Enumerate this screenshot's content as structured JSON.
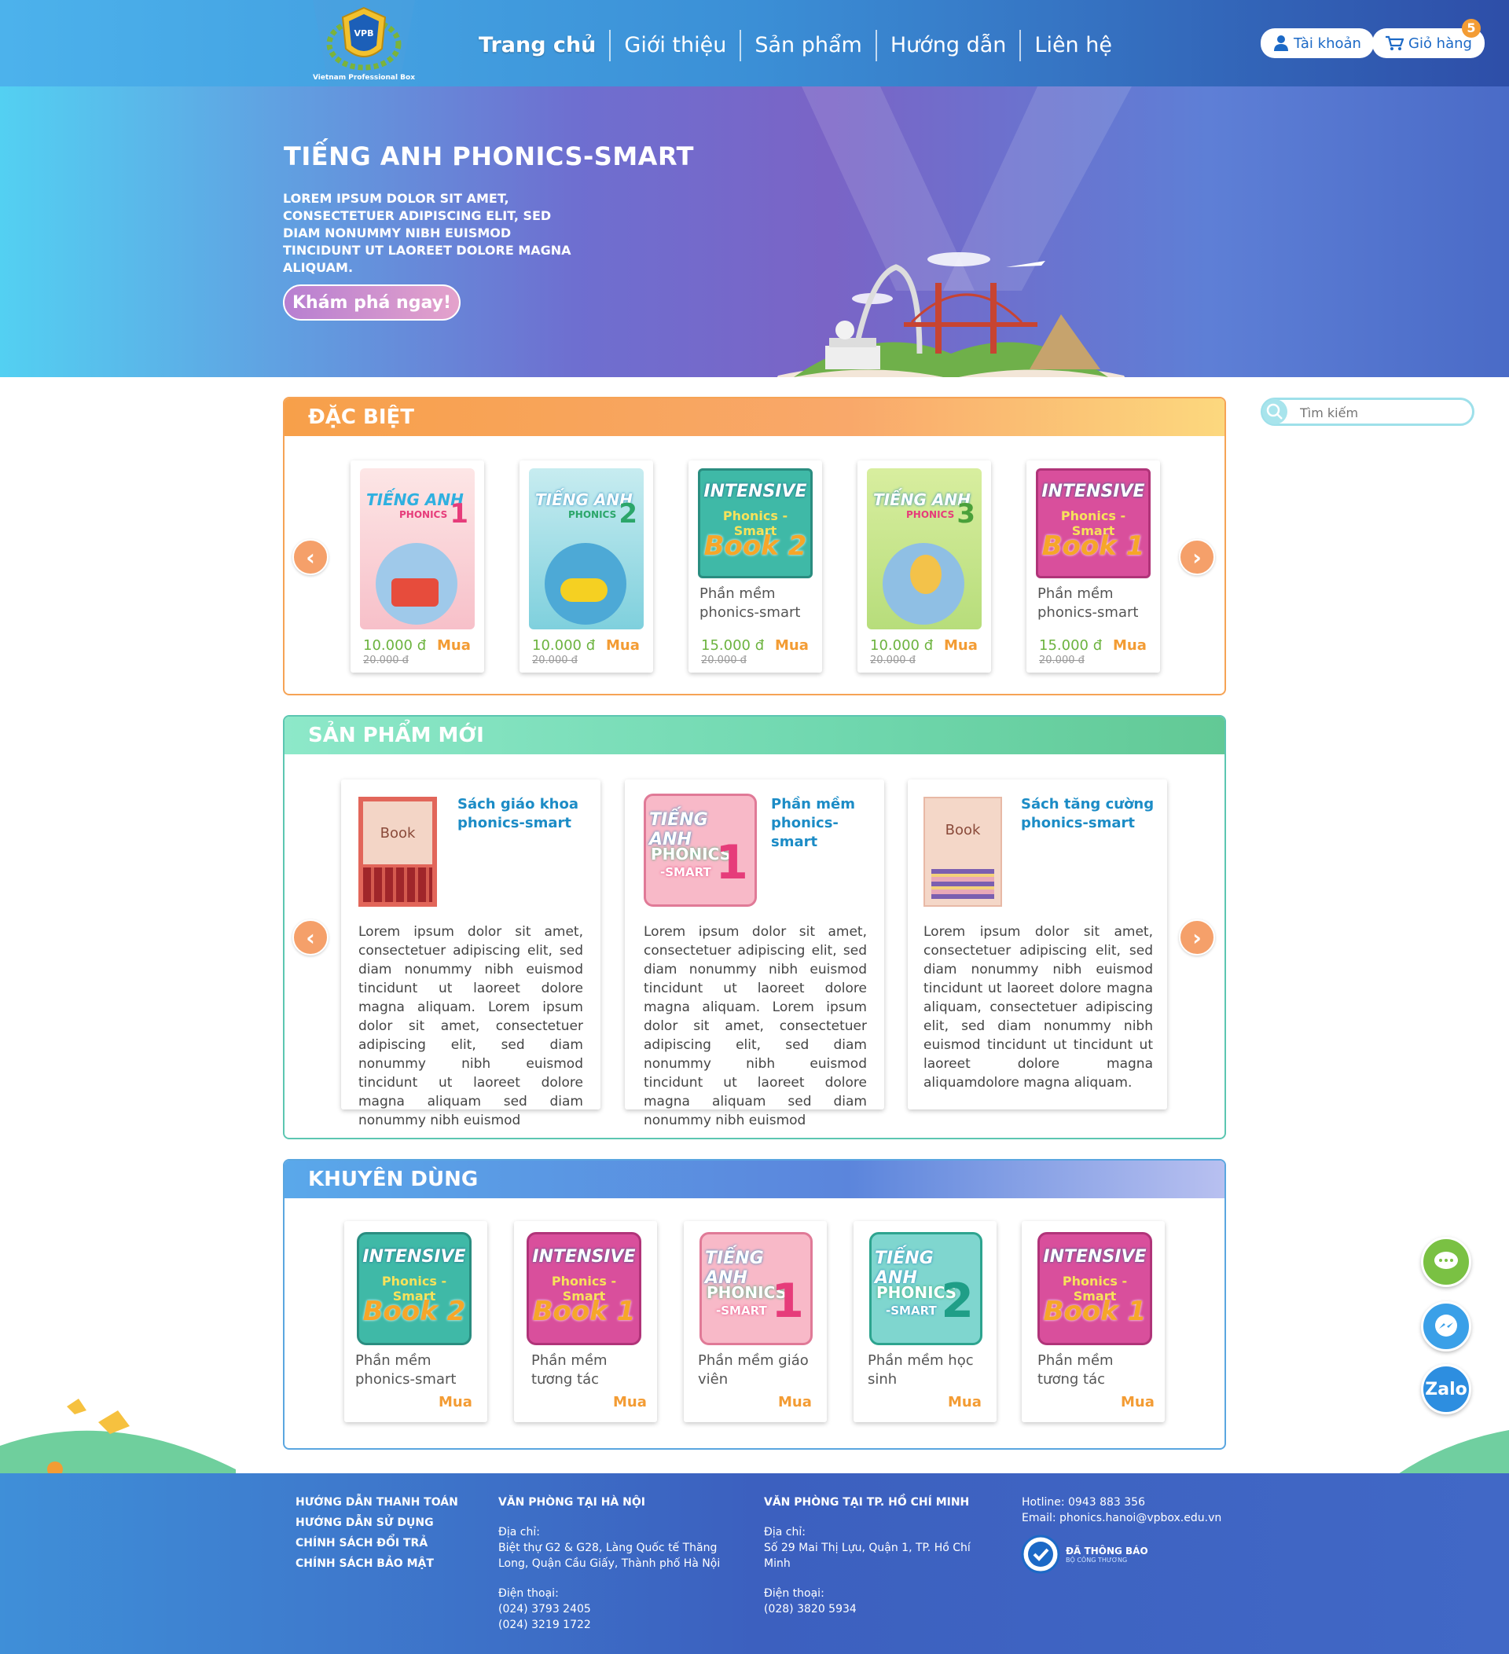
{
  "header": {
    "logo_text": "Vietnam Professional Box",
    "nav": [
      "Trang chủ",
      "Giới thiệu",
      "Sản phẩm",
      "Hướng dẫn",
      "Liên hệ"
    ],
    "account_label": "Tài khoản",
    "cart_label": "Giỏ hàng",
    "cart_count": "5"
  },
  "hero": {
    "title": "TIẾNG ANH PHONICS-SMART",
    "text": "LOREM IPSUM DOLOR SIT AMET, CONSECTETUER ADIPISCING ELIT, SED DIAM NONUMMY NIBH EUISMOD TINCIDUNT UT LAOREET DOLORE MAGNA ALIQUAM.",
    "button": "Khám phá ngay!"
  },
  "search": {
    "placeholder": "Tìm kiếm"
  },
  "special": {
    "title": "ĐẶC BIỆT",
    "items": [
      {
        "cover": "tieng-anh-1",
        "name": "",
        "price": "10.000 đ",
        "old_price": "20.000 đ",
        "buy": "Mua"
      },
      {
        "cover": "tieng-anh-2",
        "name": "",
        "price": "10.000 đ",
        "old_price": "20.000 đ",
        "buy": "Mua"
      },
      {
        "cover": "intensive-book-2",
        "name": "Phần mềm phonics-smart",
        "price": "15.000 đ",
        "old_price": "20.000 đ",
        "buy": "Mua"
      },
      {
        "cover": "tieng-anh-3",
        "name": "",
        "price": "10.000 đ",
        "old_price": "20.000 đ",
        "buy": "Mua"
      },
      {
        "cover": "intensive-book-1",
        "name": "Phần mềm phonics-smart",
        "price": "15.000 đ",
        "old_price": "20.000 đ",
        "buy": "Mua"
      }
    ]
  },
  "new_products": {
    "title": "SẢN PHẨM MỚI",
    "items": [
      {
        "title": "Sách giáo khoa phonics-smart",
        "cover_text": "Book",
        "text": "Lorem ipsum dolor sit amet, consectetuer adipiscing elit, sed diam nonummy nibh euismod tincidunt ut laoreet dolore magna aliquam. Lorem ipsum dolor sit amet, consectetuer adipiscing elit, sed diam nonummy nibh euismod tincidunt ut laoreet dolore magna aliquam sed diam nonummy nibh euismod"
      },
      {
        "title": "Phần mềm phonics-smart",
        "cover_text": "TIẾNG ANH PHONICS-SMART 1",
        "text": "Lorem ipsum dolor sit amet, consectetuer adipiscing elit, sed diam nonummy nibh euismod tincidunt ut laoreet dolore magna aliquam. Lorem ipsum dolor sit amet, consectetuer adipiscing elit, sed diam nonummy nibh euismod tincidunt ut laoreet dolore magna aliquam sed diam nonummy nibh euismod"
      },
      {
        "title": "Sách tăng cường phonics-smart",
        "cover_text": "Book",
        "text": "Lorem ipsum dolor sit amet, consectetuer adipiscing elit, sed diam nonummy nibh euismod tincidunt ut laoreet dolore magna aliquam, consectetuer adipiscing elit, sed diam nonummy nibh euismod tincidunt ut tincidunt ut laoreet dolore magna aliquamdolore magna aliquam."
      }
    ]
  },
  "recommended": {
    "title": "KHUYÊN DÙNG",
    "items": [
      {
        "cover": "intensive-book-2",
        "name": "Phần mềm phonics-smart",
        "buy": "Mua"
      },
      {
        "cover": "intensive-book-1",
        "name": "Phần mềm tương tác",
        "buy": "Mua"
      },
      {
        "cover": "tieng-anh-phonics-1",
        "name": "Phần mềm giáo viên",
        "buy": "Mua"
      },
      {
        "cover": "tieng-anh-phonics-2",
        "name": "Phần mềm học sinh",
        "buy": "Mua"
      },
      {
        "cover": "intensive-book-1",
        "name": "Phần mềm tương tác",
        "buy": "Mua"
      }
    ]
  },
  "cover_labels": {
    "intensive": "INTENSIVE",
    "phonics_smart": "Phonics - Smart",
    "book": "Book",
    "tieng_anh": "TIẾNG ANH",
    "phonics": "PHONICS",
    "smart": "-SMART"
  },
  "floating": {
    "zalo": "Zalo"
  },
  "footer": {
    "links": [
      "HƯỚNG DẪN THANH TOÁN",
      "HƯỚNG DẪN SỬ DỤNG",
      "CHÍNH SÁCH ĐỔI TRẢ",
      "CHÍNH SÁCH BẢO MẬT"
    ],
    "hanoi": {
      "title": "VĂN PHÒNG TẠI HÀ NỘI",
      "address_label": "Địa chỉ:",
      "address": "Biệt thự G2 & G28, Làng Quốc tế Thăng Long, Quận Cầu Giấy, Thành phố Hà Nội",
      "phone_label": "Điện thoại:",
      "phone1": "(024) 3793 2405",
      "phone2": "(024) 3219 1722"
    },
    "hcm": {
      "title": "VĂN PHÒNG TẠI TP. HỒ CHÍ MINH",
      "address_label": "Địa chỉ:",
      "address": "Số 29 Mai Thị Lựu, Quận 1, TP. Hồ Chí Minh",
      "phone_label": "Điện thoại:",
      "phone": "(028) 3820 5934"
    },
    "hotline": "Hotline: 0943 883 356",
    "email": "Email: phonics.hanoi@vpbox.edu.vn",
    "badge_title": "ĐÃ THÔNG BÁO",
    "badge_sub": "BỘ CÔNG THƯƠNG"
  },
  "colors": {
    "accent_orange": "#f39c34",
    "price_green": "#6cb33f",
    "link_blue": "#1c69c6"
  }
}
